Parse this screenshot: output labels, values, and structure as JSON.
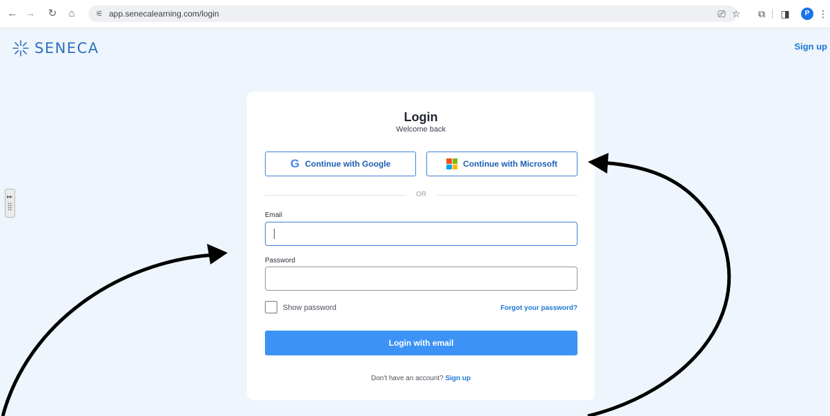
{
  "browser": {
    "url": "app.senecalearning.com/login",
    "profile_initial": "P"
  },
  "header": {
    "logo_text": "SENECA",
    "signup_link": "Sign up"
  },
  "login_card": {
    "title": "Login",
    "subtitle": "Welcome back",
    "google_button": "Continue with Google",
    "google_glyph": "G",
    "microsoft_button": "Continue with Microsoft",
    "or_divider": "OR",
    "email_label": "Email",
    "email_value": "",
    "password_label": "Password",
    "password_value": "",
    "show_password_label": "Show password",
    "show_password_checked": false,
    "forgot_password": "Forgot your password?",
    "login_button": "Login with email",
    "footer_text": "Don't have an account?",
    "footer_link": "Sign up"
  },
  "colors": {
    "accent": "#3d93f5",
    "link": "#1d78d6",
    "background": "#eef5fc"
  }
}
